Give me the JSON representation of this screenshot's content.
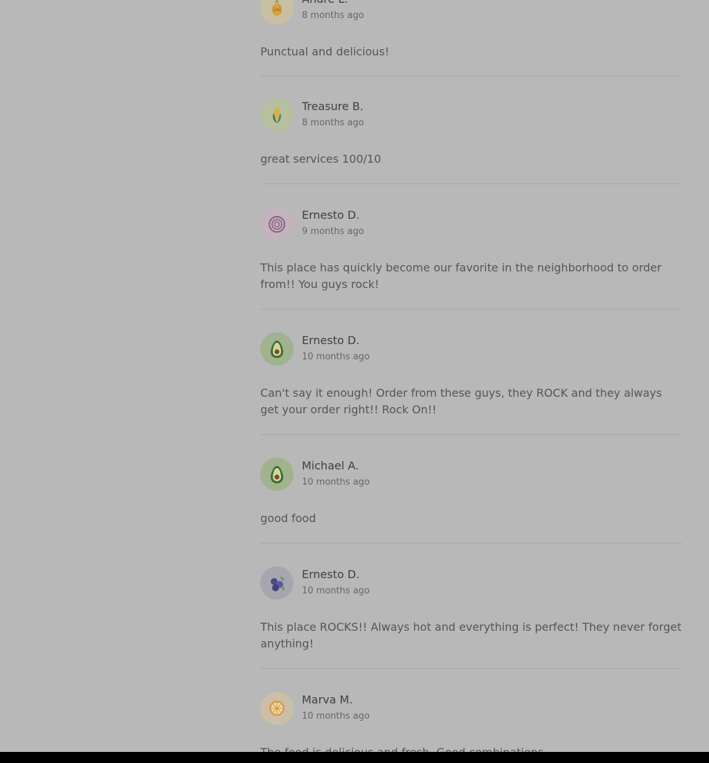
{
  "reviews": [
    {
      "name": "Andre L.",
      "time": "8 months ago",
      "text": "Punctual and delicious!",
      "avatar": "pineapple-icon",
      "avatar_bg": "#c9c0a3"
    },
    {
      "name": "Treasure B.",
      "time": "8 months ago",
      "text": "great services 100/10",
      "avatar": "corn-icon",
      "avatar_bg": "#b7c09e"
    },
    {
      "name": "Ernesto D.",
      "time": "9 months ago",
      "text": "This place has quickly become our favorite in the neighborhood to order from!! You guys rock!",
      "avatar": "onion-icon",
      "avatar_bg": "#c2b3bd"
    },
    {
      "name": "Ernesto D.",
      "time": "10 months ago",
      "text": "Can't say it enough! Order from these guys, they ROCK and they always get your order right!! Rock On!!",
      "avatar": "avocado-icon",
      "avatar_bg": "#9fb38e"
    },
    {
      "name": "Michael A.",
      "time": "10 months ago",
      "text": "good food",
      "avatar": "avocado-icon",
      "avatar_bg": "#9fb38e"
    },
    {
      "name": "Ernesto D.",
      "time": "10 months ago",
      "text": "This place ROCKS!! Always hot and everything is perfect! They never forget anything!",
      "avatar": "blueberry-icon",
      "avatar_bg": "#a6a6b1"
    },
    {
      "name": "Marva M.",
      "time": "10 months ago",
      "text": "The food is delicious and fresh. Good combinations",
      "avatar": "lemon-icon",
      "avatar_bg": "#cbbfa7"
    }
  ]
}
